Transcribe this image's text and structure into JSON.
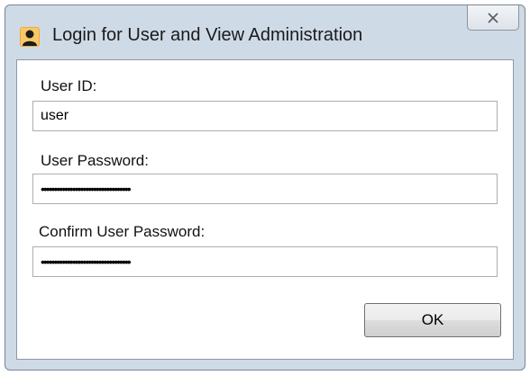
{
  "window": {
    "title": "Login for User and View Administration",
    "icon": "user-silhouette-icon",
    "close_icon": "close-icon"
  },
  "form": {
    "user_id_label": "User ID:",
    "user_id_value": "user",
    "user_password_label": "User Password:",
    "user_password_value": "••••••••••••••••••••••••••••••••••",
    "confirm_password_label": "Confirm User Password:",
    "confirm_password_value": "••••••••••••••••••••••••••••••••••"
  },
  "buttons": {
    "ok_label": "OK"
  },
  "colors": {
    "frame": "#cfdae7",
    "client": "#ffffff",
    "field_border": "#abadb3"
  }
}
